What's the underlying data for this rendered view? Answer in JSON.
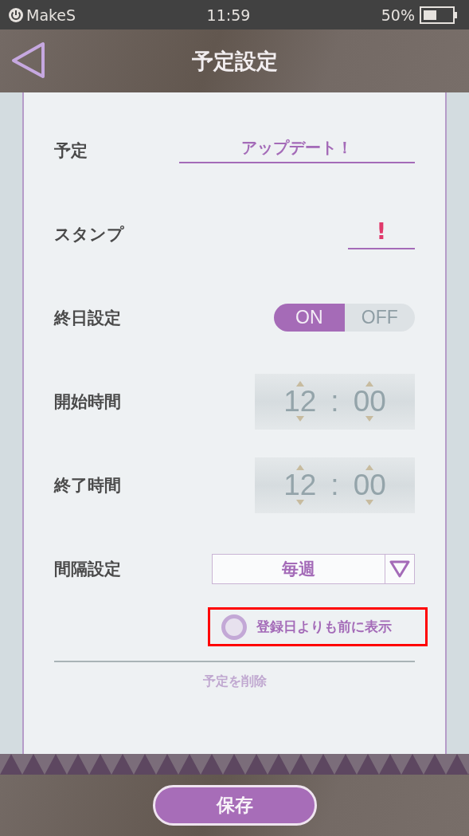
{
  "status_bar": {
    "app": "MakeS",
    "time": "11:59",
    "battery": "50%"
  },
  "header": {
    "title": "予定設定"
  },
  "rows": [
    {
      "kind": "text",
      "label": "予定",
      "value": "アップデート！"
    },
    {
      "kind": "stamp",
      "label": "スタンプ",
      "value": "!"
    },
    {
      "kind": "toggle",
      "label": "終日設定",
      "on_label": "ON",
      "off_label": "OFF",
      "on": true
    },
    {
      "kind": "time",
      "label": "開始時間",
      "hour": "12",
      "sep": ":",
      "minute": "00"
    },
    {
      "kind": "time",
      "label": "終了時間",
      "hour": "12",
      "sep": ":",
      "minute": "00"
    },
    {
      "kind": "select",
      "label": "間隔設定",
      "value": "毎週"
    }
  ],
  "option": {
    "label": "登録日よりも前に表示",
    "checked": false,
    "highlighted": true
  },
  "delete_link": "予定を削除",
  "save_button": "保存"
}
